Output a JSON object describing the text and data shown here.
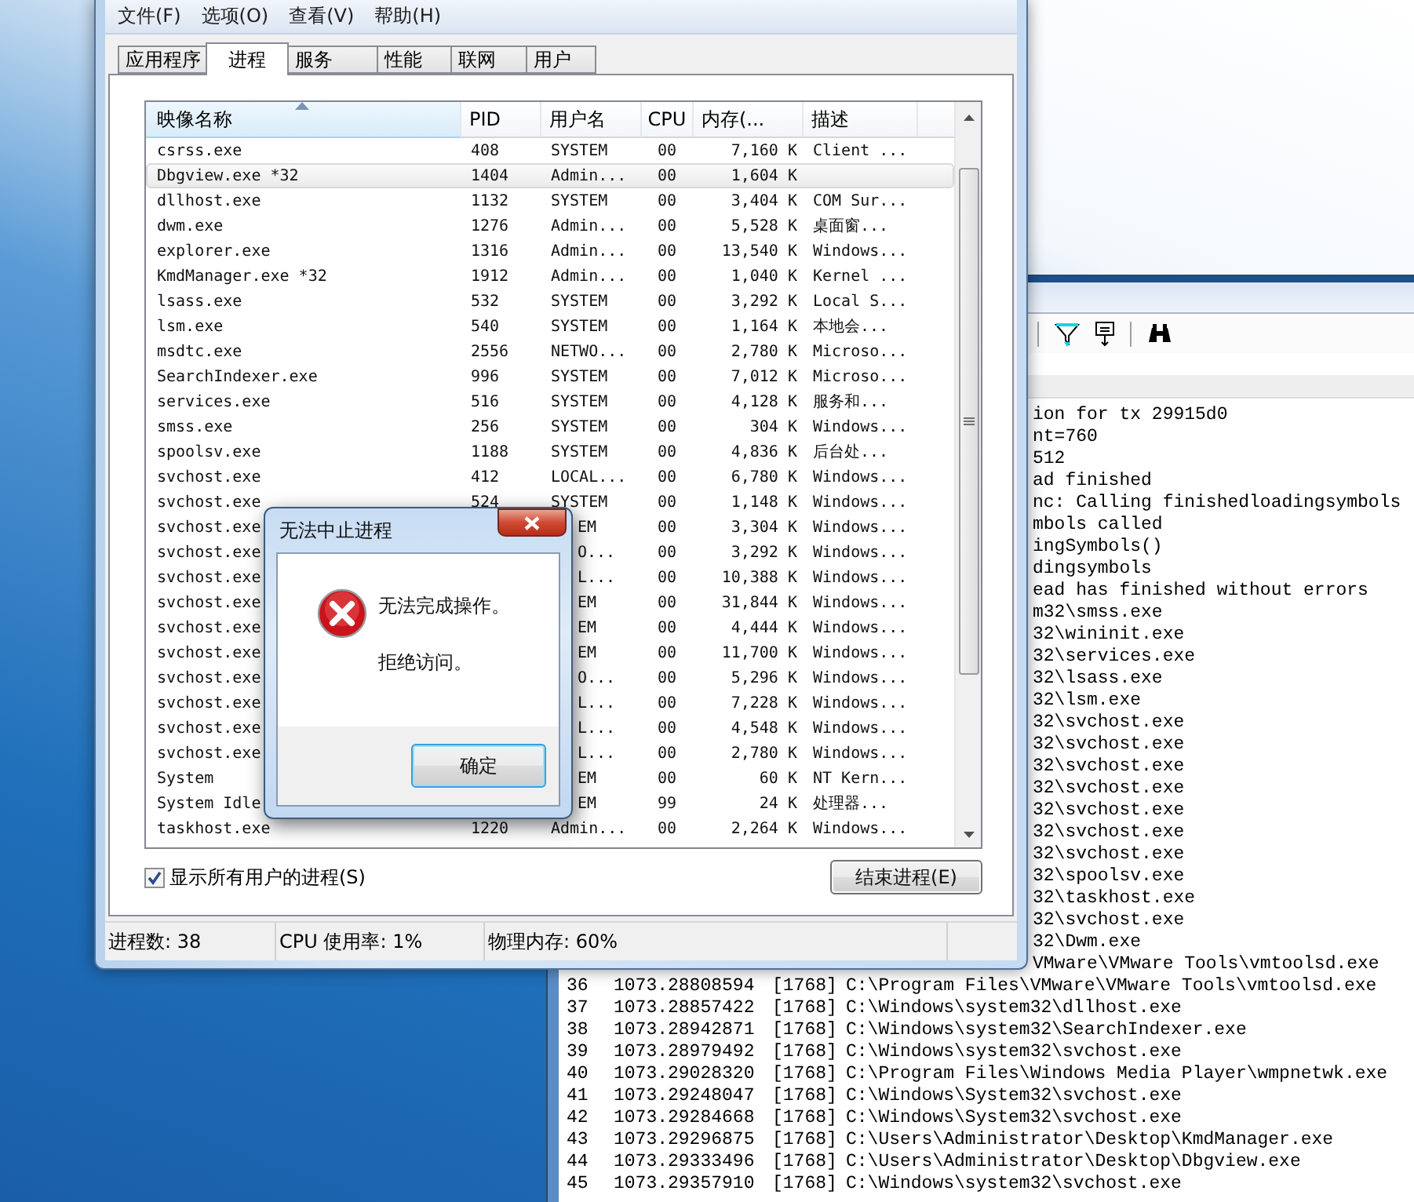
{
  "task_manager": {
    "menu": [
      "文件(F)",
      "选项(O)",
      "查看(V)",
      "帮助(H)"
    ],
    "tabs": [
      {
        "label": "应用程序",
        "selected": false
      },
      {
        "label": "进程",
        "selected": true
      },
      {
        "label": "服务",
        "selected": false
      },
      {
        "label": "性能",
        "selected": false
      },
      {
        "label": "联网",
        "selected": false
      },
      {
        "label": "用户",
        "selected": false
      }
    ],
    "table": {
      "columns": [
        "映像名称",
        "PID",
        "用户名",
        "CPU",
        "内存(...",
        "描述"
      ],
      "rows": [
        {
          "name": "csrss.exe",
          "pid": "408",
          "user": "SYSTEM",
          "cpu": "00",
          "memory": "7,160 K",
          "description": "Client ...",
          "selected": false
        },
        {
          "name": "Dbgview.exe *32",
          "pid": "1404",
          "user": "Admin...",
          "cpu": "00",
          "memory": "1,604 K",
          "selected": true
        },
        {
          "name": "dllhost.exe",
          "pid": "1132",
          "user": "SYSTEM",
          "cpu": "00",
          "memory": "3,404 K",
          "description": "COM Sur...",
          "selected": false
        },
        {
          "name": "dwm.exe",
          "pid": "1276",
          "user": "Admin...",
          "cpu": "00",
          "memory": "5,528 K",
          "description": "桌面窗...",
          "selected": false
        },
        {
          "name": "explorer.exe",
          "pid": "1316",
          "user": "Admin...",
          "cpu": "00",
          "memory": "13,540 K",
          "description": "Windows...",
          "selected": false
        },
        {
          "name": "KmdManager.exe *32",
          "pid": "1912",
          "user": "Admin...",
          "cpu": "00",
          "memory": "1,040 K",
          "description": "Kernel ...",
          "selected": false
        },
        {
          "name": "lsass.exe",
          "pid": "532",
          "user": "SYSTEM",
          "cpu": "00",
          "memory": "3,292 K",
          "description": "Local S...",
          "selected": false
        },
        {
          "name": "lsm.exe",
          "pid": "540",
          "user": "SYSTEM",
          "cpu": "00",
          "memory": "1,164 K",
          "description": "本地会...",
          "selected": false
        },
        {
          "name": "msdtc.exe",
          "pid": "2556",
          "user": "NETWO...",
          "cpu": "00",
          "memory": "2,780 K",
          "description": "Microso...",
          "selected": false
        },
        {
          "name": "SearchIndexer.exe",
          "pid": "996",
          "user": "SYSTEM",
          "cpu": "00",
          "memory": "7,012 K",
          "description": "Microso...",
          "selected": false
        },
        {
          "name": "services.exe",
          "pid": "516",
          "user": "SYSTEM",
          "cpu": "00",
          "memory": "4,128 K",
          "description": "服务和...",
          "selected": false
        },
        {
          "name": "smss.exe",
          "pid": "256",
          "user": "SYSTEM",
          "cpu": "00",
          "memory": "304 K",
          "description": "Windows...",
          "selected": false
        },
        {
          "name": "spoolsv.exe",
          "pid": "1188",
          "user": "SYSTEM",
          "cpu": "00",
          "memory": "4,836 K",
          "description": "后台处...",
          "selected": false
        },
        {
          "name": "svchost.exe",
          "pid": "412",
          "user": "LOCAL...",
          "cpu": "00",
          "memory": "6,780 K",
          "description": "Windows...",
          "selected": false
        },
        {
          "name": "svchost.exe",
          "pid": "524",
          "user": "SYSTEM",
          "cpu": "00",
          "memory": "1,148 K",
          "description": "Windows...",
          "selected": false
        },
        {
          "name": "svchost.exe",
          "user": "EM",
          "cpu": "00",
          "memory": "3,304 K",
          "description": "Windows...",
          "selected": false
        },
        {
          "name": "svchost.exe",
          "user": "O...",
          "cpu": "00",
          "memory": "3,292 K",
          "description": "Windows...",
          "selected": false
        },
        {
          "name": "svchost.exe",
          "user": "L...",
          "cpu": "00",
          "memory": "10,388 K",
          "description": "Windows...",
          "selected": false
        },
        {
          "name": "svchost.exe",
          "user": "EM",
          "cpu": "00",
          "memory": "31,844 K",
          "description": "Windows...",
          "selected": false
        },
        {
          "name": "svchost.exe",
          "user": "EM",
          "cpu": "00",
          "memory": "4,444 K",
          "description": "Windows...",
          "selected": false
        },
        {
          "name": "svchost.exe",
          "user": "EM",
          "cpu": "00",
          "memory": "11,700 K",
          "description": "Windows...",
          "selected": false
        },
        {
          "name": "svchost.exe",
          "user": "O...",
          "cpu": "00",
          "memory": "5,296 K",
          "description": "Windows...",
          "selected": false
        },
        {
          "name": "svchost.exe",
          "user": "L...",
          "cpu": "00",
          "memory": "7,228 K",
          "description": "Windows...",
          "selected": false
        },
        {
          "name": "svchost.exe",
          "user": "L...",
          "cpu": "00",
          "memory": "4,548 K",
          "description": "Windows...",
          "selected": false
        },
        {
          "name": "svchost.exe",
          "user": "L...",
          "cpu": "00",
          "memory": "2,780 K",
          "description": "Windows...",
          "selected": false
        },
        {
          "name": "System",
          "user": "EM",
          "cpu": "00",
          "memory": "60 K",
          "description": "NT Kern...",
          "selected": false
        },
        {
          "name": "System Idle",
          "user": "EM",
          "cpu": "99",
          "memory": "24 K",
          "description": "处理器...",
          "selected": false
        },
        {
          "name": "taskhost.exe",
          "pid": "1220",
          "user": "Admin...",
          "cpu": "00",
          "memory": "2,264 K",
          "description": "Windows...",
          "selected": false
        }
      ]
    },
    "show_all_users": {
      "label": "显示所有用户的进程(S)",
      "checked": true
    },
    "end_process_button": "结束进程(E)",
    "status_bar": [
      "进程数: 38",
      "CPU 使用率: 1%",
      "物理内存: 60%"
    ]
  },
  "dialog": {
    "title": "无法中止进程",
    "message": "无法完成操作。",
    "detail": "拒绝访问。",
    "buttons": [
      "确定"
    ]
  },
  "debug_view": {
    "lines": [
      {
        "kind": "partial",
        "text": "ion for tx 29915d0"
      },
      {
        "kind": "partial",
        "text": "nt=760"
      },
      {
        "kind": "partial",
        "text": "512"
      },
      {
        "kind": "partial",
        "text": "ad finished"
      },
      {
        "kind": "partial",
        "text": "nc: Calling finishedloadingsymbols"
      },
      {
        "kind": "partial",
        "text": "mbols called"
      },
      {
        "kind": "partial",
        "text": "ingSymbols()"
      },
      {
        "kind": "partial",
        "text": "dingsymbols"
      },
      {
        "kind": "partial",
        "text": "ead has finished without errors"
      },
      {
        "kind": "partial",
        "text": "m32\\smss.exe"
      },
      {
        "kind": "partial",
        "text": "32\\wininit.exe"
      },
      {
        "kind": "partial",
        "text": "32\\services.exe"
      },
      {
        "kind": "partial",
        "text": "32\\lsass.exe"
      },
      {
        "kind": "partial",
        "text": "32\\lsm.exe"
      },
      {
        "kind": "partial",
        "text": "32\\svchost.exe"
      },
      {
        "kind": "partial",
        "text": "32\\svchost.exe"
      },
      {
        "kind": "partial",
        "text": "32\\svchost.exe"
      },
      {
        "kind": "partial",
        "text": "32\\svchost.exe"
      },
      {
        "kind": "partial",
        "text": "32\\svchost.exe"
      },
      {
        "kind": "partial",
        "text": "32\\svchost.exe"
      },
      {
        "kind": "partial",
        "text": "32\\svchost.exe"
      },
      {
        "kind": "partial",
        "text": "32\\spoolsv.exe"
      },
      {
        "kind": "partial",
        "text": "32\\taskhost.exe"
      },
      {
        "kind": "partial",
        "text": "32\\svchost.exe"
      },
      {
        "kind": "partial",
        "text": "32\\Dwm.exe"
      },
      {
        "kind": "partial",
        "text": "VMware\\VMware Tools\\vmtoolsd.exe"
      },
      {
        "kind": "entry",
        "index": "36",
        "time": "1073.28808594",
        "pid": "[1768]",
        "text": "C:\\Program Files\\VMware\\VMware Tools\\vmtoolsd.exe"
      },
      {
        "kind": "entry",
        "index": "37",
        "time": "1073.28857422",
        "pid": "[1768]",
        "text": "C:\\Windows\\system32\\dllhost.exe"
      },
      {
        "kind": "entry",
        "index": "38",
        "time": "1073.28942871",
        "pid": "[1768]",
        "text": "C:\\Windows\\system32\\SearchIndexer.exe"
      },
      {
        "kind": "entry",
        "index": "39",
        "time": "1073.28979492",
        "pid": "[1768]",
        "text": "C:\\Windows\\system32\\svchost.exe"
      },
      {
        "kind": "entry",
        "index": "40",
        "time": "1073.29028320",
        "pid": "[1768]",
        "text": "C:\\Program Files\\Windows Media Player\\wmpnetwk.exe"
      },
      {
        "kind": "entry",
        "index": "41",
        "time": "1073.29248047",
        "pid": "[1768]",
        "text": "C:\\Windows\\System32\\svchost.exe"
      },
      {
        "kind": "entry",
        "index": "42",
        "time": "1073.29284668",
        "pid": "[1768]",
        "text": "C:\\Windows\\System32\\svchost.exe"
      },
      {
        "kind": "entry",
        "index": "43",
        "time": "1073.29296875",
        "pid": "[1768]",
        "text": "C:\\Users\\Administrator\\Desktop\\KmdManager.exe"
      },
      {
        "kind": "entry",
        "index": "44",
        "time": "1073.29333496",
        "pid": "[1768]",
        "text": "C:\\Users\\Administrator\\Desktop\\Dbgview.exe"
      },
      {
        "kind": "entry",
        "index": "45",
        "time": "1073.29357910",
        "pid": "[1768]",
        "text": "C:\\Windows\\system32\\svchost.exe"
      }
    ]
  }
}
